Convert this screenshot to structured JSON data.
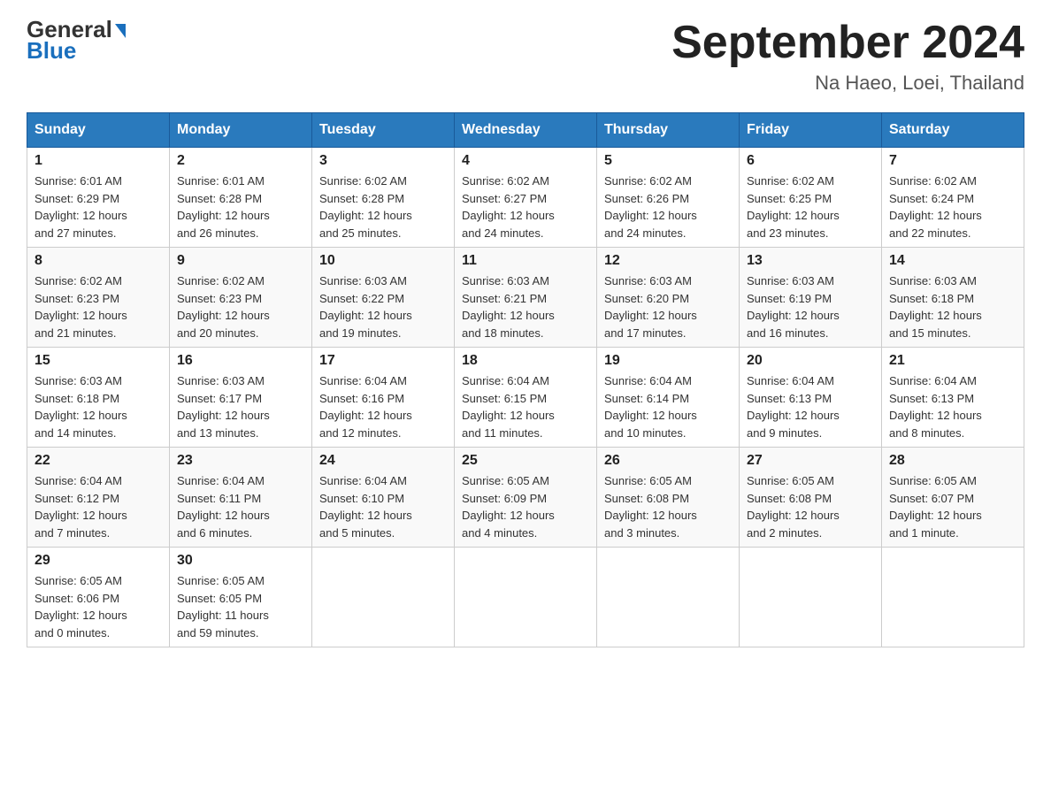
{
  "logo": {
    "line1_black": "General",
    "line1_blue_arrow": "▶",
    "line2": "Blue"
  },
  "title": "September 2024",
  "subtitle": "Na Haeo, Loei, Thailand",
  "weekdays": [
    "Sunday",
    "Monday",
    "Tuesday",
    "Wednesday",
    "Thursday",
    "Friday",
    "Saturday"
  ],
  "weeks": [
    [
      {
        "day": "1",
        "sunrise": "6:01 AM",
        "sunset": "6:29 PM",
        "daylight": "12 hours and 27 minutes."
      },
      {
        "day": "2",
        "sunrise": "6:01 AM",
        "sunset": "6:28 PM",
        "daylight": "12 hours and 26 minutes."
      },
      {
        "day": "3",
        "sunrise": "6:02 AM",
        "sunset": "6:28 PM",
        "daylight": "12 hours and 25 minutes."
      },
      {
        "day": "4",
        "sunrise": "6:02 AM",
        "sunset": "6:27 PM",
        "daylight": "12 hours and 24 minutes."
      },
      {
        "day": "5",
        "sunrise": "6:02 AM",
        "sunset": "6:26 PM",
        "daylight": "12 hours and 24 minutes."
      },
      {
        "day": "6",
        "sunrise": "6:02 AM",
        "sunset": "6:25 PM",
        "daylight": "12 hours and 23 minutes."
      },
      {
        "day": "7",
        "sunrise": "6:02 AM",
        "sunset": "6:24 PM",
        "daylight": "12 hours and 22 minutes."
      }
    ],
    [
      {
        "day": "8",
        "sunrise": "6:02 AM",
        "sunset": "6:23 PM",
        "daylight": "12 hours and 21 minutes."
      },
      {
        "day": "9",
        "sunrise": "6:02 AM",
        "sunset": "6:23 PM",
        "daylight": "12 hours and 20 minutes."
      },
      {
        "day": "10",
        "sunrise": "6:03 AM",
        "sunset": "6:22 PM",
        "daylight": "12 hours and 19 minutes."
      },
      {
        "day": "11",
        "sunrise": "6:03 AM",
        "sunset": "6:21 PM",
        "daylight": "12 hours and 18 minutes."
      },
      {
        "day": "12",
        "sunrise": "6:03 AM",
        "sunset": "6:20 PM",
        "daylight": "12 hours and 17 minutes."
      },
      {
        "day": "13",
        "sunrise": "6:03 AM",
        "sunset": "6:19 PM",
        "daylight": "12 hours and 16 minutes."
      },
      {
        "day": "14",
        "sunrise": "6:03 AM",
        "sunset": "6:18 PM",
        "daylight": "12 hours and 15 minutes."
      }
    ],
    [
      {
        "day": "15",
        "sunrise": "6:03 AM",
        "sunset": "6:18 PM",
        "daylight": "12 hours and 14 minutes."
      },
      {
        "day": "16",
        "sunrise": "6:03 AM",
        "sunset": "6:17 PM",
        "daylight": "12 hours and 13 minutes."
      },
      {
        "day": "17",
        "sunrise": "6:04 AM",
        "sunset": "6:16 PM",
        "daylight": "12 hours and 12 minutes."
      },
      {
        "day": "18",
        "sunrise": "6:04 AM",
        "sunset": "6:15 PM",
        "daylight": "12 hours and 11 minutes."
      },
      {
        "day": "19",
        "sunrise": "6:04 AM",
        "sunset": "6:14 PM",
        "daylight": "12 hours and 10 minutes."
      },
      {
        "day": "20",
        "sunrise": "6:04 AM",
        "sunset": "6:13 PM",
        "daylight": "12 hours and 9 minutes."
      },
      {
        "day": "21",
        "sunrise": "6:04 AM",
        "sunset": "6:13 PM",
        "daylight": "12 hours and 8 minutes."
      }
    ],
    [
      {
        "day": "22",
        "sunrise": "6:04 AM",
        "sunset": "6:12 PM",
        "daylight": "12 hours and 7 minutes."
      },
      {
        "day": "23",
        "sunrise": "6:04 AM",
        "sunset": "6:11 PM",
        "daylight": "12 hours and 6 minutes."
      },
      {
        "day": "24",
        "sunrise": "6:04 AM",
        "sunset": "6:10 PM",
        "daylight": "12 hours and 5 minutes."
      },
      {
        "day": "25",
        "sunrise": "6:05 AM",
        "sunset": "6:09 PM",
        "daylight": "12 hours and 4 minutes."
      },
      {
        "day": "26",
        "sunrise": "6:05 AM",
        "sunset": "6:08 PM",
        "daylight": "12 hours and 3 minutes."
      },
      {
        "day": "27",
        "sunrise": "6:05 AM",
        "sunset": "6:08 PM",
        "daylight": "12 hours and 2 minutes."
      },
      {
        "day": "28",
        "sunrise": "6:05 AM",
        "sunset": "6:07 PM",
        "daylight": "12 hours and 1 minute."
      }
    ],
    [
      {
        "day": "29",
        "sunrise": "6:05 AM",
        "sunset": "6:06 PM",
        "daylight": "12 hours and 0 minutes."
      },
      {
        "day": "30",
        "sunrise": "6:05 AM",
        "sunset": "6:05 PM",
        "daylight": "11 hours and 59 minutes."
      },
      null,
      null,
      null,
      null,
      null
    ]
  ],
  "labels": {
    "sunrise": "Sunrise:",
    "sunset": "Sunset:",
    "daylight": "Daylight:"
  }
}
